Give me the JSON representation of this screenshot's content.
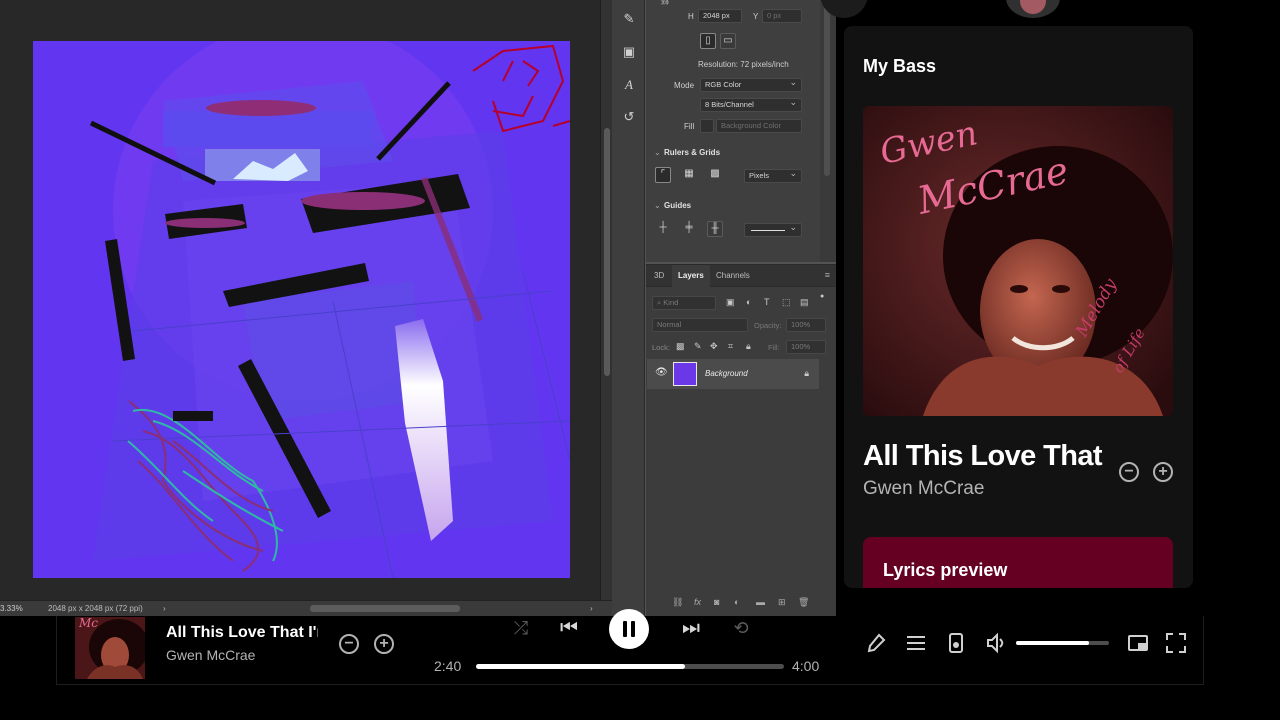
{
  "photoshop": {
    "status_zoom": "3.33%",
    "status_doc": "2048 px x 2048 px (72 ppi)",
    "properties": {
      "h_label": "H",
      "h_value": "2048 px",
      "y_label": "Y",
      "y_value": "0 px",
      "resolution": "Resolution: 72 pixels/inch",
      "mode_label": "Mode",
      "mode_value": "RGB Color",
      "depth_value": "8 Bits/Channel",
      "fill_label": "Fill",
      "fill_value": "Background Color",
      "rulers_grids": "Rulers & Grids",
      "units_value": "Pixels",
      "guides": "Guides"
    },
    "layers": {
      "tabs": [
        "3D",
        "Layers",
        "Channels"
      ],
      "kind_placeholder": "Kind",
      "blend_mode": "Normal",
      "opacity_label": "Opacity:",
      "opacity_value": "100%",
      "lock_label": "Lock:",
      "fill_label": "Fill:",
      "fill_value": "100%",
      "layer_name": "Background"
    }
  },
  "spotify": {
    "panel_heading": "My Bass",
    "track_title": "All This Love That",
    "artist": "Gwen McCrae",
    "album_cover_lettering": "Gwen McCrae",
    "album_cover_subtitle": "Melody of Life",
    "lyrics_label": "Lyrics preview",
    "player": {
      "title": "All This Love That I'm Giving",
      "artist": "Gwen McCrae",
      "elapsed": "2:40",
      "total": "4:00",
      "progress_fraction": 0.68,
      "volume_fraction": 0.79
    },
    "icons": [
      "shuffle-icon",
      "previous-icon",
      "pause-icon",
      "next-icon",
      "repeat-icon",
      "microphone-icon",
      "queue-icon",
      "connect-device-icon",
      "volume-icon",
      "miniplayer-icon",
      "fullscreen-icon",
      "remove-icon",
      "add-icon"
    ],
    "colors": {
      "lyrics_bg": "#650023",
      "panel_bg": "#121212",
      "canvas_purple": "#6a38e8"
    }
  }
}
